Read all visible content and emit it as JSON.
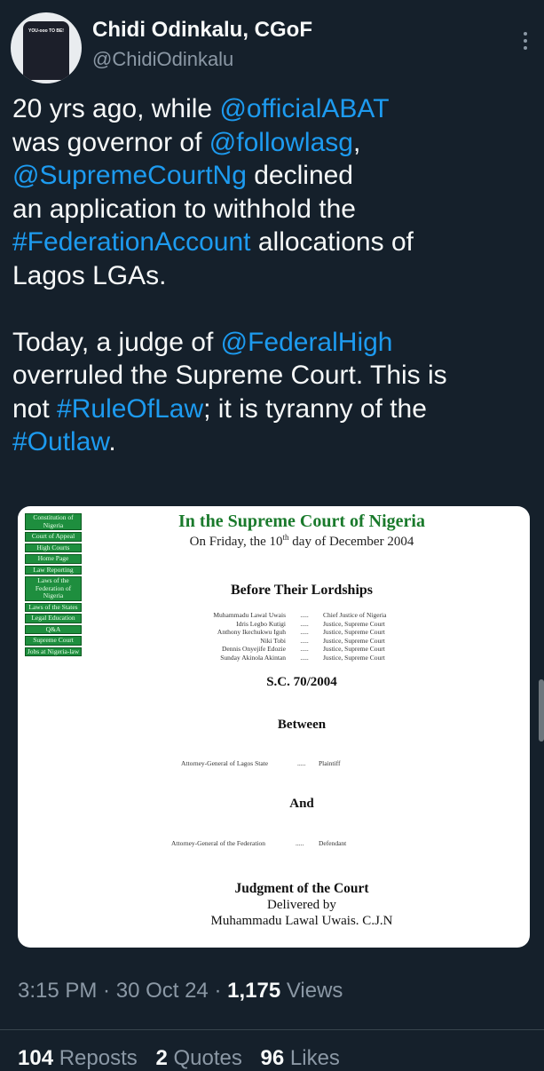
{
  "author": {
    "name": "Chidi Odinkalu, CGoF",
    "handle": "@ChidiOdinkalu",
    "avatar_shirt_text": "YOU-ooo TO BE!"
  },
  "tweet": {
    "line1_a": "20 yrs ago, while ",
    "mention_abat": "@officialABAT",
    "line2_a": "was governor of ",
    "mention_lasg": "@followlasg",
    "line2_b": ",",
    "mention_court": "@SupremeCourtNg",
    "line3_b": " declined",
    "line4": "an application to withhold the",
    "hashtag_fed": "#FederationAccount",
    "line5_b": " allocations of",
    "line6": "Lagos LGAs.",
    "line7_a": "Today, a judge of ",
    "mention_high": "@FederalHigh",
    "line8": "overruled the Supreme Court. This is",
    "line9_a": "not ",
    "hashtag_rule": "#RuleOfLaw",
    "line9_b": "; it is tyranny of the",
    "hashtag_outlaw": "#Outlaw",
    "line10_b": "."
  },
  "document": {
    "nav": [
      "Constitution of Nigeria",
      "Court of Appeal",
      "High Courts",
      "Home Page",
      "Law Reporting",
      "Laws of the Federation of Nigeria",
      "Laws of the States",
      "Legal Education",
      "Q&A",
      "Supreme Court",
      "Jobs at Nigeria-law"
    ],
    "court": "In the Supreme Court of Nigeria",
    "date_a": "On Friday, the 10",
    "date_sup": "th",
    "date_b": " day of December 2004",
    "before": "Before Their Lordships",
    "judges": [
      {
        "name": "Muhammadu Lawal Uwais",
        "dots": ".....",
        "role": "Chief Justice of Nigeria"
      },
      {
        "name": "Idris Legbo Kutigi",
        "dots": ".....",
        "role": "Justice, Supreme Court"
      },
      {
        "name": "Anthony Ikechukwu Iguh",
        "dots": ".....",
        "role": "Justice, Supreme Court"
      },
      {
        "name": "Niki Tobi",
        "dots": ".....",
        "role": "Justice, Supreme Court"
      },
      {
        "name": "Dennis Onyejife Edozie",
        "dots": ".....",
        "role": "Justice, Supreme Court"
      },
      {
        "name": "Sunday Akinola Akintan",
        "dots": ".....",
        "role": "Justice, Supreme Court"
      }
    ],
    "case_no": "S.C. 70/2004",
    "between": "Between",
    "plaintiff_name": "Attorney-General of Lagos State",
    "plaintiff_dots": ".....",
    "plaintiff_role": "Plaintiff",
    "and": "And",
    "defendant_name": "Attorney-General of the Federation",
    "defendant_dots": ".....",
    "defendant_role": "Defendant",
    "judgment": "Judgment of the Court",
    "delivered": "Delivered by",
    "delivered_by": "Muhammadu Lawal Uwais. C.J.N"
  },
  "meta": {
    "time": "3:15 PM",
    "sep1": " · ",
    "date": "30 Oct 24",
    "sep2": " · ",
    "views_count": "1,175",
    "views_label": " Views"
  },
  "stats": {
    "reposts_count": "104",
    "reposts_label": " Reposts",
    "quotes_count": "2",
    "quotes_label": " Quotes",
    "likes_count": "96",
    "likes_label": " Likes"
  }
}
